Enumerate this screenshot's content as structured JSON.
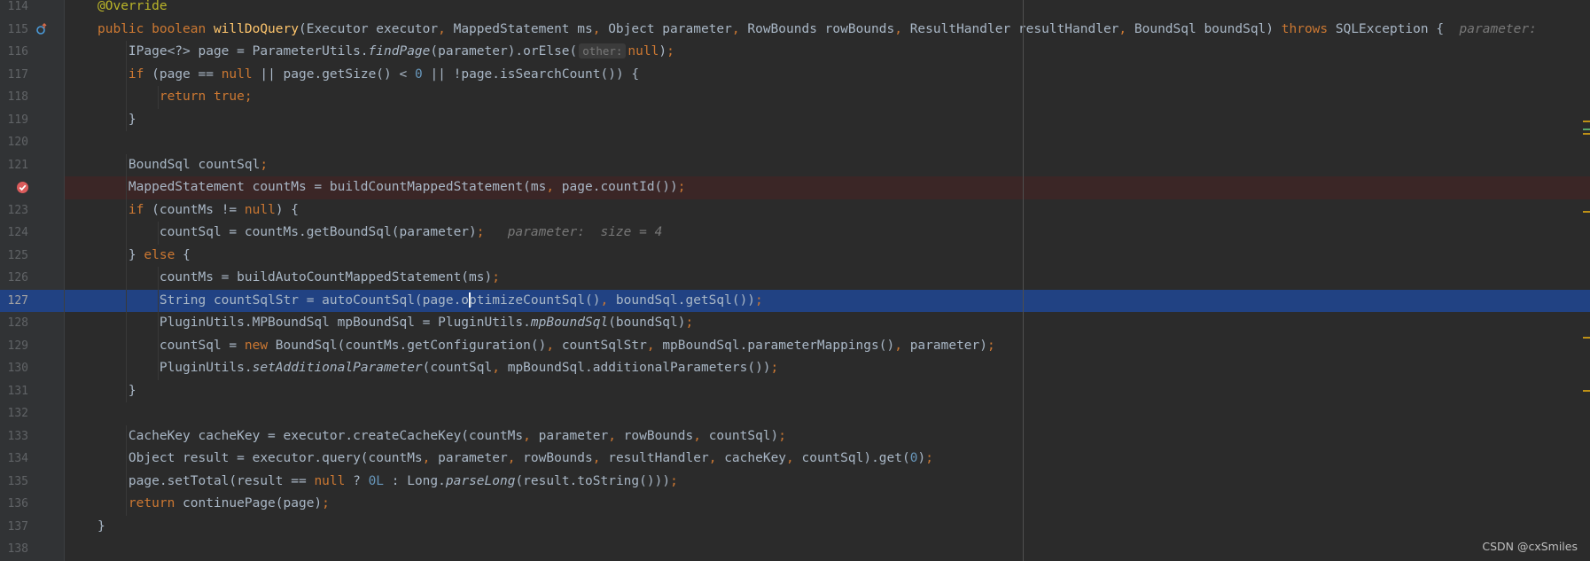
{
  "editor": {
    "lines": [
      {
        "n": "114",
        "code": [
          {
            "t": "@Override",
            "c": "ann"
          }
        ]
      },
      {
        "n": "115",
        "code": [
          {
            "t": "public ",
            "c": "kw"
          },
          {
            "t": "boolean ",
            "c": "kw"
          },
          {
            "t": "willDoQuery",
            "c": "fn"
          },
          {
            "t": "(Executor executor"
          },
          {
            "t": ", ",
            "c": "kw"
          },
          {
            "t": "MappedStatement ms"
          },
          {
            "t": ", ",
            "c": "kw"
          },
          {
            "t": "Object parameter"
          },
          {
            "t": ", ",
            "c": "kw"
          },
          {
            "t": "RowBounds rowBounds"
          },
          {
            "t": ", ",
            "c": "kw"
          },
          {
            "t": "ResultHandler resultHandler"
          },
          {
            "t": ", ",
            "c": "kw"
          },
          {
            "t": "BoundSql boundSql) "
          },
          {
            "t": "throws ",
            "c": "kw"
          },
          {
            "t": "SQLException {  "
          },
          {
            "t": "parameter: ",
            "c": "inl"
          }
        ]
      },
      {
        "n": "116",
        "code": [
          {
            "t": "    IPage<?> page = ParameterUtils."
          },
          {
            "t": "findPage",
            "c": "it"
          },
          {
            "t": "(parameter).orElse("
          },
          {
            "t": "other:",
            "c": "hint"
          },
          {
            "t": "null",
            "c": "kw"
          },
          {
            "t": ")"
          },
          {
            "t": ";",
            "c": "kw"
          }
        ]
      },
      {
        "n": "117",
        "code": [
          {
            "t": "    "
          },
          {
            "t": "if ",
            "c": "kw"
          },
          {
            "t": "(page == "
          },
          {
            "t": "null ",
            "c": "kw"
          },
          {
            "t": "|| page.getSize() < "
          },
          {
            "t": "0 ",
            "c": "num"
          },
          {
            "t": "|| !page.isSearchCount()) {"
          }
        ]
      },
      {
        "n": "118",
        "code": [
          {
            "t": "        "
          },
          {
            "t": "return true;",
            "c": "kw"
          }
        ]
      },
      {
        "n": "119",
        "code": [
          {
            "t": "    }"
          }
        ]
      },
      {
        "n": "120",
        "code": []
      },
      {
        "n": "121",
        "code": [
          {
            "t": "    BoundSql countSql"
          },
          {
            "t": ";",
            "c": "kw"
          }
        ]
      },
      {
        "n": "",
        "code": [
          {
            "t": "    MappedStatement countMs = buildCountMappedStatement(ms"
          },
          {
            "t": ", ",
            "c": "kw"
          },
          {
            "t": "page.countId())"
          },
          {
            "t": ";",
            "c": "kw"
          }
        ]
      },
      {
        "n": "123",
        "code": [
          {
            "t": "    "
          },
          {
            "t": "if ",
            "c": "kw"
          },
          {
            "t": "(countMs != "
          },
          {
            "t": "null",
            "c": "kw"
          },
          {
            "t": ") {"
          }
        ]
      },
      {
        "n": "124",
        "code": [
          {
            "t": "        countSql = countMs.getBoundSql(parameter)"
          },
          {
            "t": ";",
            "c": "kw"
          },
          {
            "t": "   "
          },
          {
            "t": "parameter:  size = 4",
            "c": "inl"
          }
        ]
      },
      {
        "n": "125",
        "code": [
          {
            "t": "    } "
          },
          {
            "t": "else ",
            "c": "kw"
          },
          {
            "t": "{"
          }
        ]
      },
      {
        "n": "126",
        "code": [
          {
            "t": "        countMs = buildAutoCountMappedStatement(ms)"
          },
          {
            "t": ";",
            "c": "kw"
          }
        ]
      },
      {
        "n": "127",
        "code": [
          {
            "t": "        String countSqlStr = autoCountSql(page.o"
          },
          {
            "t": "",
            "c": "caret"
          },
          {
            "t": "ptimizeCountSql()"
          },
          {
            "t": ", ",
            "c": "kw"
          },
          {
            "t": "boundSql.getSql())"
          },
          {
            "t": ";",
            "c": "kw"
          }
        ]
      },
      {
        "n": "128",
        "code": [
          {
            "t": "        PluginUtils.MPBoundSql mpBoundSql = PluginUtils."
          },
          {
            "t": "mpBoundSql",
            "c": "it"
          },
          {
            "t": "(boundSql)"
          },
          {
            "t": ";",
            "c": "kw"
          }
        ]
      },
      {
        "n": "129",
        "code": [
          {
            "t": "        countSql = "
          },
          {
            "t": "new ",
            "c": "kw"
          },
          {
            "t": "BoundSql(countMs.getConfiguration()"
          },
          {
            "t": ", ",
            "c": "kw"
          },
          {
            "t": "countSqlStr"
          },
          {
            "t": ", ",
            "c": "kw"
          },
          {
            "t": "mpBoundSql.parameterMappings()"
          },
          {
            "t": ", ",
            "c": "kw"
          },
          {
            "t": "parameter)"
          },
          {
            "t": ";",
            "c": "kw"
          }
        ]
      },
      {
        "n": "130",
        "code": [
          {
            "t": "        PluginUtils."
          },
          {
            "t": "setAdditionalParameter",
            "c": "it"
          },
          {
            "t": "(countSql"
          },
          {
            "t": ", ",
            "c": "kw"
          },
          {
            "t": "mpBoundSql.additionalParameters())"
          },
          {
            "t": ";",
            "c": "kw"
          }
        ]
      },
      {
        "n": "131",
        "code": [
          {
            "t": "    }"
          }
        ]
      },
      {
        "n": "132",
        "code": []
      },
      {
        "n": "133",
        "code": [
          {
            "t": "    CacheKey cacheKey = executor.createCacheKey(countMs"
          },
          {
            "t": ", ",
            "c": "kw"
          },
          {
            "t": "parameter"
          },
          {
            "t": ", ",
            "c": "kw"
          },
          {
            "t": "rowBounds"
          },
          {
            "t": ", ",
            "c": "kw"
          },
          {
            "t": "countSql)"
          },
          {
            "t": ";",
            "c": "kw"
          }
        ]
      },
      {
        "n": "134",
        "code": [
          {
            "t": "    Object result = executor.query(countMs"
          },
          {
            "t": ", ",
            "c": "kw"
          },
          {
            "t": "parameter"
          },
          {
            "t": ", ",
            "c": "kw"
          },
          {
            "t": "rowBounds"
          },
          {
            "t": ", ",
            "c": "kw"
          },
          {
            "t": "resultHandler"
          },
          {
            "t": ", ",
            "c": "kw"
          },
          {
            "t": "cacheKey"
          },
          {
            "t": ", ",
            "c": "kw"
          },
          {
            "t": "countSql).get("
          },
          {
            "t": "0",
            "c": "num"
          },
          {
            "t": ")"
          },
          {
            "t": ";",
            "c": "kw"
          }
        ]
      },
      {
        "n": "135",
        "code": [
          {
            "t": "    page.setTotal(result == "
          },
          {
            "t": "null ",
            "c": "kw"
          },
          {
            "t": "? "
          },
          {
            "t": "0L ",
            "c": "num"
          },
          {
            "t": ": Long."
          },
          {
            "t": "parseLong",
            "c": "it"
          },
          {
            "t": "(result.toString()))"
          },
          {
            "t": ";",
            "c": "kw"
          }
        ]
      },
      {
        "n": "136",
        "code": [
          {
            "t": "    "
          },
          {
            "t": "return ",
            "c": "kw"
          },
          {
            "t": "continuePage(page)"
          },
          {
            "t": ";",
            "c": "kw"
          }
        ]
      },
      {
        "n": "137",
        "code": [
          {
            "t": "}"
          }
        ]
      },
      {
        "n": "138",
        "code": []
      }
    ],
    "current_line": "127",
    "breakpoint_line_index": 8,
    "override_line_index": 1
  },
  "watermark": "CSDN @cxSmiles",
  "colors": {
    "background": "#2b2b2b",
    "gutter": "#313335",
    "selection": "#214283",
    "breakpoint_row": "#3b2626",
    "keyword": "#cc7832",
    "annotation": "#bbb529",
    "method": "#ffc66d",
    "number": "#6897bb"
  }
}
